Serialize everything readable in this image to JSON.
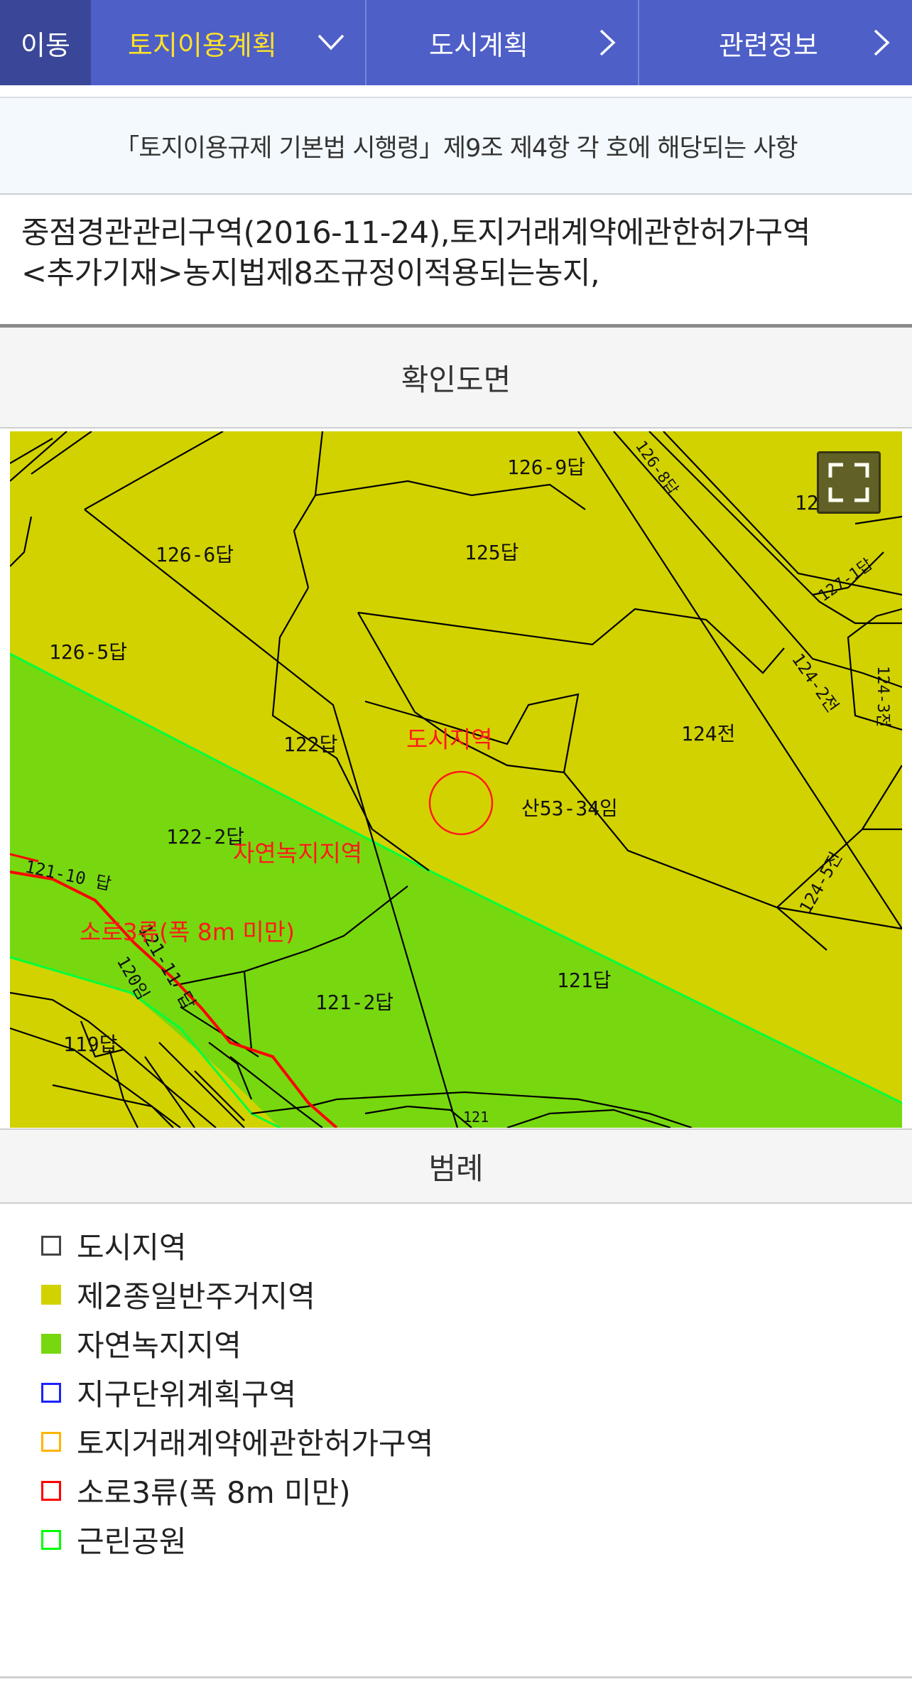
{
  "nav": {
    "move": "이동",
    "tabs": [
      {
        "label": "토지이용계획",
        "active": true,
        "icon": "chevron-down-icon"
      },
      {
        "label": "도시계획",
        "active": false,
        "icon": "chevron-right-icon"
      },
      {
        "label": "관련정보",
        "active": false,
        "icon": "chevron-right-icon"
      }
    ]
  },
  "notice": "「토지이용규제 기본법 시행령」제9조 제4항 각 호에 해당되는 사항",
  "detail": {
    "line1": "중점경관관리구역(2016-11-24),토지거래계약에관한허가구역",
    "line2": "<추가기재>농지법제8조규정이적용되는농지,"
  },
  "map": {
    "title": "확인도면",
    "parcels": [
      "126-9답",
      "126-6답",
      "125답",
      "126-5답",
      "122답",
      "124전",
      "산53-34임",
      "122-2답",
      "121-10 답",
      "121-11 답",
      "120임",
      "119답",
      "121-2답",
      "121답",
      "124-2전",
      "124-3전",
      "124-5전",
      "127-1답",
      "126-8답",
      "12",
      "121"
    ],
    "zone_labels": [
      "도시지역",
      "자연녹지지역",
      "소로3류(폭 8m 미만)"
    ],
    "colors": {
      "residential": "#d2d200",
      "green": "#77d80f",
      "road": "#ff0000",
      "park": "#00ff3c"
    }
  },
  "legend": {
    "title": "범례",
    "items": [
      {
        "label": "도시지역",
        "fill": "#ffffff",
        "border": "#444444"
      },
      {
        "label": "제2종일반주거지역",
        "fill": "#d2d200",
        "border": "#d2d200"
      },
      {
        "label": "자연녹지지역",
        "fill": "#77d80f",
        "border": "#77d80f"
      },
      {
        "label": "지구단위계획구역",
        "fill": "#ffffff",
        "border": "#1a22ff"
      },
      {
        "label": "토지거래계약에관한허가구역",
        "fill": "#ffffff",
        "border": "#ffb400"
      },
      {
        "label": "소로3류(폭 8m 미만)",
        "fill": "#ffffff",
        "border": "#ff0000"
      },
      {
        "label": "근린공원",
        "fill": "#ffffff",
        "border": "#00ff00"
      }
    ]
  }
}
